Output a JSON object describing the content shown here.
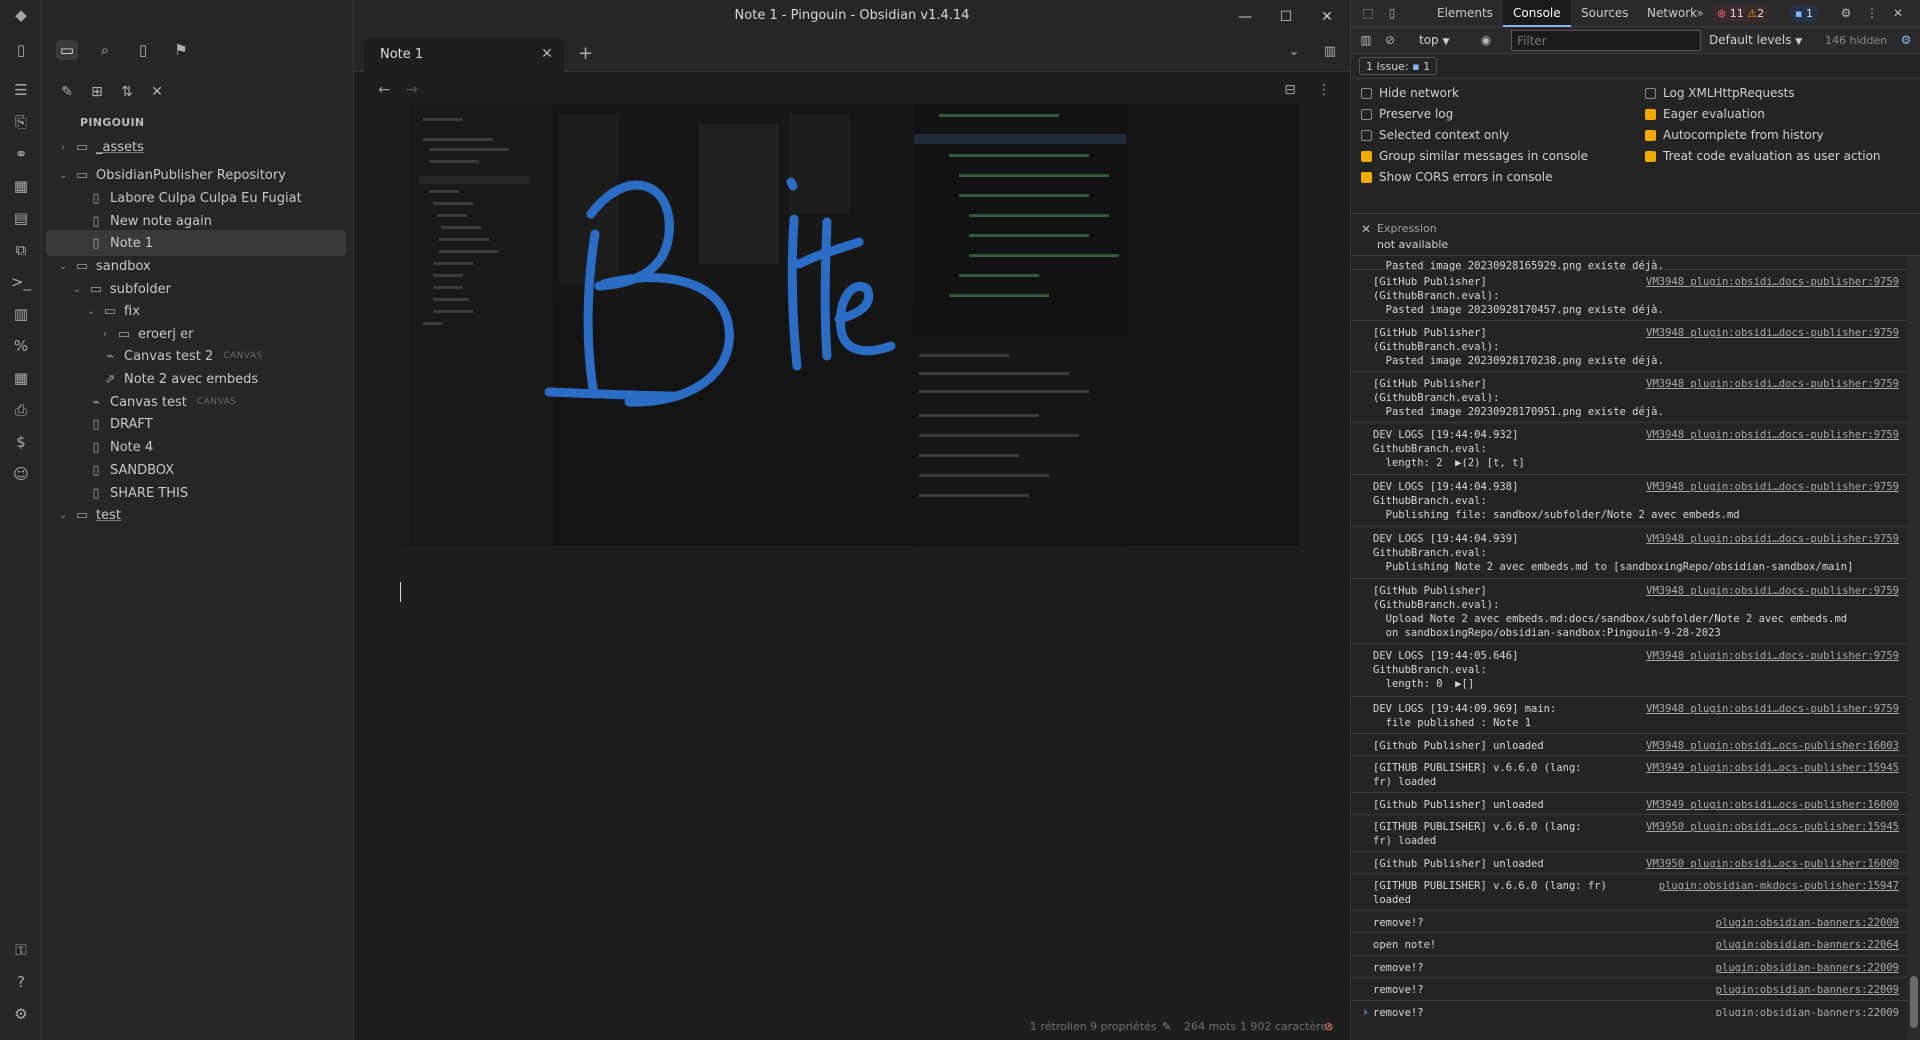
{
  "window": {
    "title": "Note 1 - Pingouin - Obsidian v1.4.14"
  },
  "ribbon": {
    "icons": [
      "obsidian-logo-icon",
      "open-quick-switcher-icon",
      "graph-view-icon",
      "canvas-icon",
      "daily-note-icon",
      "templates-icon",
      "command-palette-icon",
      "sidebar-icon",
      "percent-icon",
      "table-icon",
      "insert-icon",
      "dollar-icon",
      "face-icon",
      "vault-icon",
      "help-icon",
      "settings-icon"
    ]
  },
  "sidebar": {
    "vault": "PINGOUIN",
    "tree": [
      {
        "label": "_assets",
        "level": 0,
        "kind": "folder",
        "open": false,
        "underline": true
      },
      {
        "label": "ObsidianPublisher Repository",
        "level": 0,
        "kind": "folder",
        "open": true
      },
      {
        "label": "Labore Culpa Culpa Eu Fugiat",
        "level": 1,
        "kind": "file"
      },
      {
        "label": "New note again",
        "level": 1,
        "kind": "file"
      },
      {
        "label": "Note 1",
        "level": 1,
        "kind": "file",
        "selected": true
      },
      {
        "label": "sandbox",
        "level": 0,
        "kind": "folder",
        "open": true
      },
      {
        "label": "subfolder",
        "level": 1,
        "kind": "folder",
        "open": true
      },
      {
        "label": "fix",
        "level": 2,
        "kind": "folder",
        "open": true
      },
      {
        "label": "eroerj er",
        "level": 3,
        "kind": "folder",
        "open": false
      },
      {
        "label": "Canvas test 2",
        "level": 2,
        "kind": "canvas",
        "tag": "CANVAS"
      },
      {
        "label": "Note 2 avec embeds",
        "level": 2,
        "kind": "link"
      },
      {
        "label": "Canvas test",
        "level": 1,
        "kind": "canvas",
        "tag": "CANVAS"
      },
      {
        "label": "DRAFT",
        "level": 1,
        "kind": "file"
      },
      {
        "label": "Note 4",
        "level": 1,
        "kind": "file"
      },
      {
        "label": "SANDBOX",
        "level": 1,
        "kind": "file"
      },
      {
        "label": "SHARE THIS",
        "level": 1,
        "kind": "file"
      },
      {
        "label": "test",
        "level": 0,
        "kind": "folder",
        "open": true,
        "underline": true
      }
    ]
  },
  "tabs": [
    {
      "label": "Note 1"
    }
  ],
  "editor": {
    "drawing_text": "Bite",
    "status": {
      "backlinks": "1 rétrolien",
      "properties": "9 propriétés",
      "words": "264 mots",
      "chars": "1 902 caractères"
    }
  },
  "devtools": {
    "tabs": [
      "Elements",
      "Console",
      "Sources",
      "Network"
    ],
    "active_tab": "Console",
    "errors": "11",
    "warnings": "2",
    "infos": "1",
    "context": "top",
    "filter_placeholder": "Filter",
    "levels": "Default levels",
    "hidden": "146 hidden",
    "issues": "1 Issue:",
    "issues_count": "1",
    "settings_left": [
      {
        "label": "Hide network",
        "checked": false
      },
      {
        "label": "Preserve log",
        "checked": false
      },
      {
        "label": "Selected context only",
        "checked": false
      },
      {
        "label": "Group similar messages in console",
        "checked": true
      },
      {
        "label": "Show CORS errors in console",
        "checked": true
      }
    ],
    "settings_right": [
      {
        "label": "Log XMLHttpRequests",
        "checked": false
      },
      {
        "label": "Eager evaluation",
        "checked": true
      },
      {
        "label": "Autocomplete from history",
        "checked": true
      },
      {
        "label": "Treat code evaluation as user action",
        "checked": true
      }
    ],
    "expression_label": "Expression",
    "expression_value": "not available",
    "messages": [
      {
        "text": "  Pasted image 20230928165929.png existe déjà.",
        "src": "",
        "h": 14
      },
      {
        "text": "[GitHub Publisher]\n(GithubBranch.eval):\n  Pasted image 20230928170457.png existe déjà.",
        "src": "VM3948 plugin:obsidi…docs-publisher:9759",
        "h": 49
      },
      {
        "text": "[GitHub Publisher]\n(GithubBranch.eval):\n  Pasted image 20230928170238.png existe déjà.",
        "src": "VM3948 plugin:obsidi…docs-publisher:9759",
        "h": 49
      },
      {
        "text": "[GitHub Publisher]\n(GithubBranch.eval):\n  Pasted image 20230928170951.png existe déjà.",
        "src": "VM3948 plugin:obsidi…docs-publisher:9759",
        "h": 49
      },
      {
        "text": "DEV LOGS [19:44:04.932]\nGithubBranch.eval:\n  length: 2  ▶(2) [t, t]",
        "src": "VM3948 plugin:obsidi…docs-publisher:9759",
        "h": 50
      },
      {
        "text": "DEV LOGS [19:44:04.938]\nGithubBranch.eval:\n  Publishing file: sandbox/subfolder/Note 2 avec embeds.md",
        "src": "VM3948 plugin:obsidi…docs-publisher:9759",
        "h": 50
      },
      {
        "text": "DEV LOGS [19:44:04.939]\nGithubBranch.eval:\n  Publishing Note 2 avec embeds.md to [sandboxingRepo/obsidian-sandbox/main]",
        "src": "VM3948 plugin:obsidi…docs-publisher:9759",
        "h": 50
      },
      {
        "text": "[GitHub Publisher]\n(GithubBranch.eval):\n  Upload Note 2 avec embeds.md:docs/sandbox/subfolder/Note 2 avec embeds.md\n  on sandboxingRepo/obsidian-sandbox:Pingouin-9-28-2023",
        "src": "VM3948 plugin:obsidi…docs-publisher:9759",
        "h": 63
      },
      {
        "text": "DEV LOGS [19:44:05.646]\nGithubBranch.eval:\n  length: 0  ▶[]",
        "src": "VM3948 plugin:obsidi…docs-publisher:9759",
        "h": 51
      },
      {
        "text": "DEV LOGS [19:44:09.969] main:\n  file published : Note 1",
        "src": "VM3948 plugin:obsidi…docs-publisher:9759",
        "h": 35
      },
      {
        "text": "[Github Publisher] unloaded",
        "src": "VM3948 plugin:obsidi…ocs-publisher:16003",
        "h": 20
      },
      {
        "text": "[GITHUB PUBLISHER] v.6.6.0 (lang:\nfr) loaded",
        "src": "VM3949 plugin:obsidi…ocs-publisher:15945",
        "h": 35
      },
      {
        "text": "[Github Publisher] unloaded",
        "src": "VM3949 plugin:obsidi…ocs-publisher:16000",
        "h": 20
      },
      {
        "text": "[GITHUB PUBLISHER] v.6.6.0 (lang:\nfr) loaded",
        "src": "VM3950 plugin:obsidi…ocs-publisher:15945",
        "h": 35
      },
      {
        "text": "[Github Publisher] unloaded",
        "src": "VM3950 plugin:obsidi…ocs-publisher:16000",
        "h": 20
      },
      {
        "text": "[GITHUB PUBLISHER] v.6.6.0 (lang: fr)\nloaded",
        "src": "plugin:obsidian-mkdocs-publisher:15947",
        "h": 35
      },
      {
        "text": "remove!?",
        "src": "plugin:obsidian-banners:22009",
        "h": 20
      },
      {
        "text": "open note!",
        "src": "plugin:obsidian-banners:22064",
        "h": 21
      },
      {
        "text": "remove!?",
        "src": "plugin:obsidian-banners:22009",
        "h": 20
      },
      {
        "text": "remove!?",
        "src": "plugin:obsidian-banners:22009",
        "h": 21
      },
      {
        "text": "remove!?",
        "src": "plugin:obsidian-banners:22009",
        "h": 20
      },
      {
        "text": "remove!?",
        "src": "plugin:obsidian-banners:22009",
        "h": 20
      }
    ]
  },
  "colors": {
    "accent": "#8ab4f8",
    "checkbox": "#f2a900",
    "ink": "#2b6cc4",
    "error": "#e46962",
    "warning": "#f2a900"
  }
}
